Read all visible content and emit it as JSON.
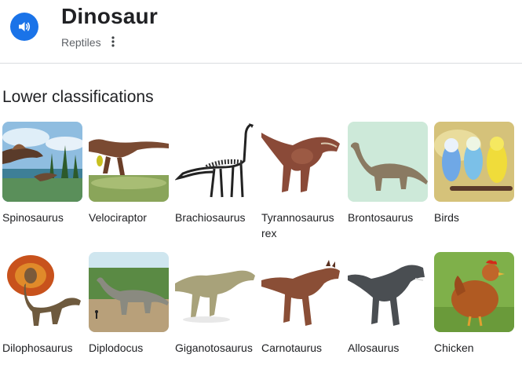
{
  "header": {
    "title": "Dinosaur",
    "subtitle": "Reptiles",
    "speaker_icon": "volume-icon",
    "more_icon": "more-vert-icon"
  },
  "section": {
    "title": "Lower classifications"
  },
  "items": [
    {
      "label": "Spinosaurus"
    },
    {
      "label": "Velociraptor"
    },
    {
      "label": "Brachiosaurus"
    },
    {
      "label": "Tyrannosaurus rex"
    },
    {
      "label": "Brontosaurus"
    },
    {
      "label": "Birds"
    },
    {
      "label": "Dilophosaurus"
    },
    {
      "label": "Diplodocus"
    },
    {
      "label": "Giganotosaurus"
    },
    {
      "label": "Carnotaurus"
    },
    {
      "label": "Allosaurus"
    },
    {
      "label": "Chicken"
    }
  ],
  "colors": {
    "accent": "#1a73e8",
    "divider": "#dadce0",
    "secondary_text": "#5f6368"
  }
}
